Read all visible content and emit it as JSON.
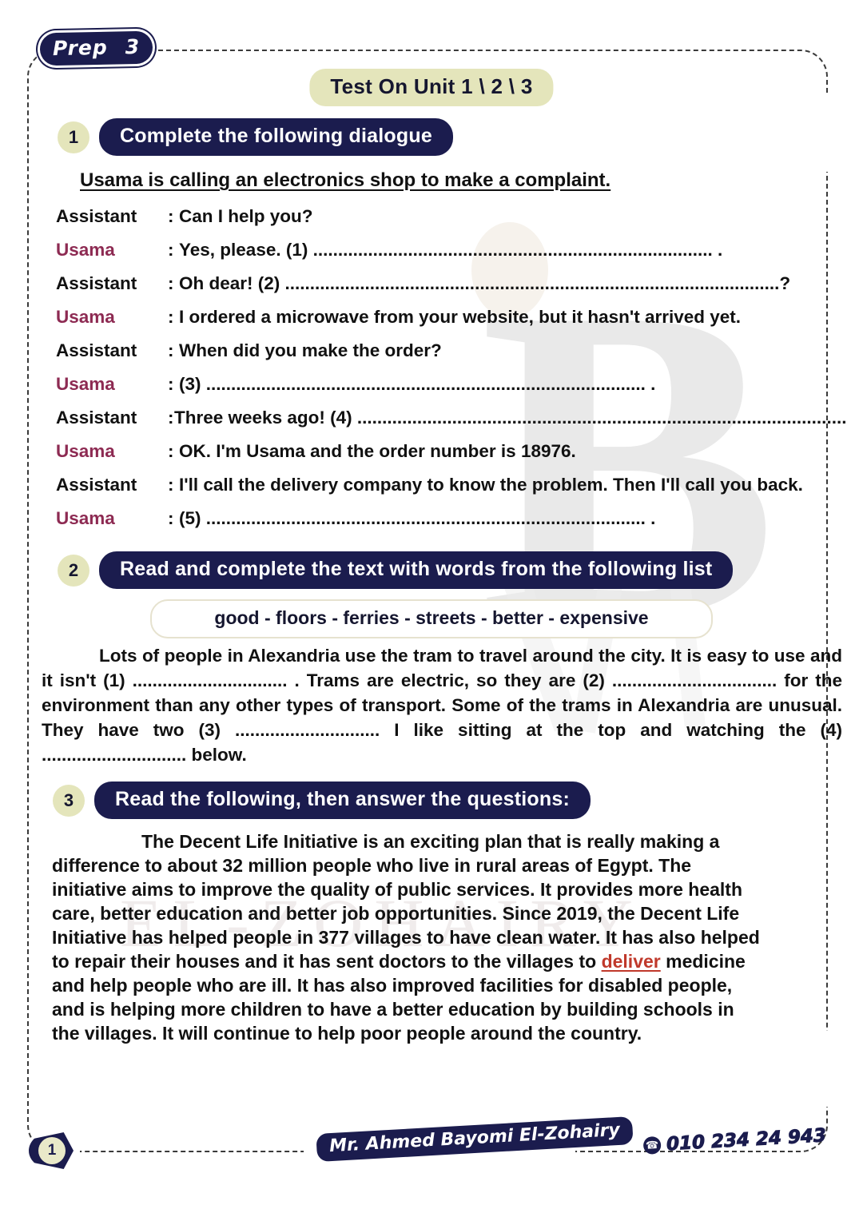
{
  "header": {
    "prep_label": "Prep",
    "prep_number": "3",
    "title": "Test On Unit 1 \\ 2 \\ 3"
  },
  "sections": [
    {
      "number": "1",
      "title": "Complete the following dialogue"
    },
    {
      "number": "2",
      "title": "Read and complete the text with words from the following list"
    },
    {
      "number": "3",
      "title": "Read the following, then answer the questions:"
    }
  ],
  "dialogue": {
    "intro": "Usama is calling an electronics shop to make a complaint.",
    "lines": [
      {
        "speaker": "Assistant",
        "colon": ":",
        "text": "Can I help you?"
      },
      {
        "speaker": "Usama",
        "colon": ":",
        "text": "Yes, please. (1) ................................................................................ ."
      },
      {
        "speaker": "Assistant",
        "colon": ":",
        "text": "Oh dear! (2) ...................................................................................................?"
      },
      {
        "speaker": "Usama",
        "colon": ":",
        "text": "I ordered a microwave from your website, but it hasn't arrived yet."
      },
      {
        "speaker": "Assistant",
        "colon": ":",
        "text": "When did you make the order?"
      },
      {
        "speaker": "Usama",
        "colon": ":",
        "text": "(3) ........................................................................................ ."
      },
      {
        "speaker": "Assistant",
        "colon": ":",
        "text": "Three weeks ago! (4) ..................................................................................................?"
      },
      {
        "speaker": "Usama",
        "colon": ":",
        "text": "OK. I'm Usama and the order number is 18976."
      },
      {
        "speaker": "Assistant",
        "colon": ":",
        "text": "I'll call the delivery company to know the problem. Then I'll call you back."
      },
      {
        "speaker": "Usama",
        "colon": ":",
        "text": "(5) ........................................................................................ ."
      }
    ]
  },
  "word_bank": "good - floors - ferries - streets - better - expensive",
  "passage_2": "Lots of people in Alexandria use the tram to travel around the city. It is easy to use and it isn't (1) ............................... . Trams are electric, so they are (2) ................................. for the environment than any other types of transport. Some of the trams in Alexandria are unusual. They have two (3) ............................. I like sitting at the top and watching the (4) ............................. below.",
  "passage_3": {
    "before_highlight": "The Decent Life Initiative is an exciting plan that is really making a difference to about 32 million people who live in rural areas of Egypt. The initiative aims to improve the quality of public services. It provides more health care, better education and better job opportunities. Since 2019, the Decent Life Initiative has helped people in 377 villages to have clean water. It has also helped to repair their houses and it has sent doctors to the villages to ",
    "highlight": "deliver",
    "after_highlight": " medicine and help people who are ill. It has also improved facilities for disabled people, and is helping more children to have a better education by building schools in the villages. It will continue to help poor people around the country."
  },
  "footer": {
    "page_number": "1",
    "teacher_name": "Mr. Ahmed Bayomi El-Zohairy",
    "phone": "010 234 24 943",
    "phone_icon": "phone-icon"
  },
  "watermark": {
    "letter": "B",
    "text": "EL-ZOHAIRY"
  },
  "colors": {
    "navy": "#1b1c4e",
    "khaki": "#e4e5bb",
    "usama_maroon": "#8d2a52",
    "highlight_red": "#c0392b"
  }
}
